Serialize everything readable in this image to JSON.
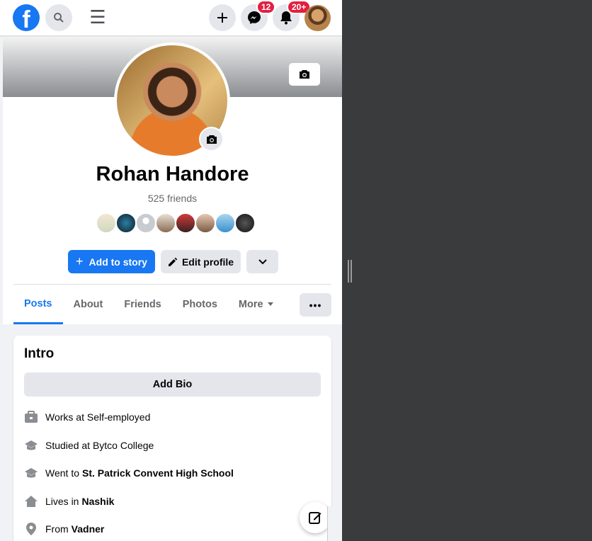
{
  "topbar": {
    "logo": "f",
    "menu_glyph": "☰",
    "messenger_badge": "12",
    "notifications_badge": "20+"
  },
  "profile": {
    "name": "Rohan Handore",
    "friends_count": "525 friends"
  },
  "actions": {
    "add_story": "Add to story",
    "add_story_icon": "+",
    "edit_profile": "Edit profile"
  },
  "tabs": [
    "Posts",
    "About",
    "Friends",
    "Photos",
    "More"
  ],
  "more_dots": "•••",
  "intro": {
    "title": "Intro",
    "add_bio": "Add Bio",
    "items": [
      {
        "icon": "briefcase-icon",
        "prefix": "Works at Self-employed",
        "bold": ""
      },
      {
        "icon": "graduation-cap-icon",
        "prefix": "Studied at Bytco College",
        "bold": ""
      },
      {
        "icon": "graduation-cap-icon",
        "prefix": "Went to",
        "bold": "St. Patrick Convent High School"
      },
      {
        "icon": "home-icon",
        "prefix": "Lives in",
        "bold": "Nashik"
      },
      {
        "icon": "location-pin-icon",
        "prefix": "From",
        "bold": "Vadner"
      }
    ]
  },
  "colors": {
    "brand": "#1877f2",
    "badge": "#e41e3f",
    "background_outer": "#3a3b3c"
  }
}
